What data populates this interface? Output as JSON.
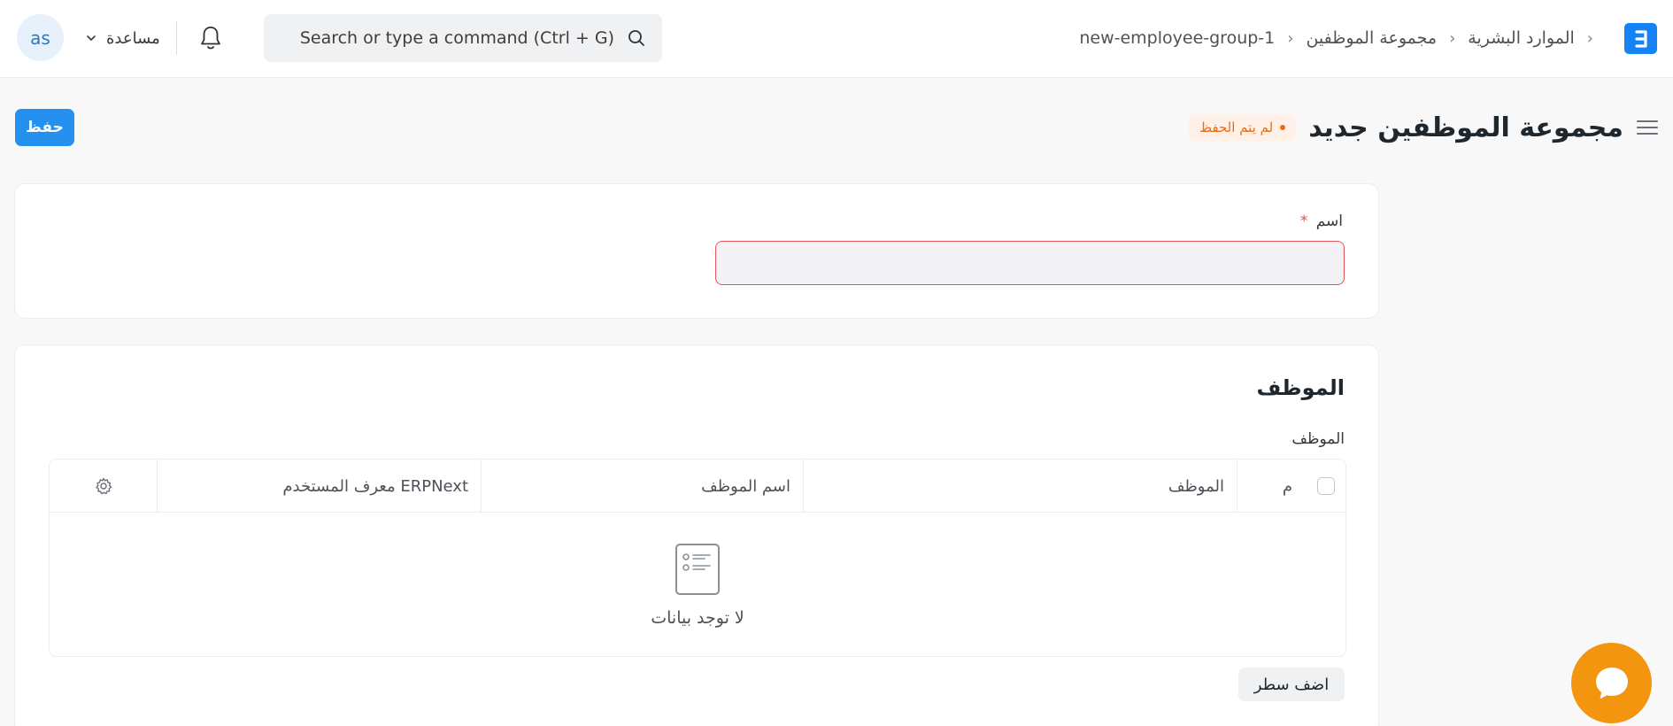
{
  "navbar": {
    "avatar_initials": "as",
    "help_label": "مساعدة",
    "search_placeholder": "Search or type a command (Ctrl + G)",
    "breadcrumb": [
      "new-employee-group-1",
      "مجموعة الموظفين",
      "الموارد البشرية"
    ]
  },
  "page": {
    "title": "مجموعة الموظفين جديد",
    "status": "لم يتم الحفظ",
    "save_label": "حفظ"
  },
  "form": {
    "name_label": "اسم",
    "required_mark": "*",
    "name_value": ""
  },
  "employees_section": {
    "title": "الموظف",
    "table_label": "الموظف",
    "columns": {
      "no": "م",
      "employee": "الموظف",
      "employee_name": "اسم الموظف",
      "erpnext_user": "معرف المستخدم ERPNext"
    },
    "empty_text": "لا توجد بيانات",
    "add_row_label": "اضف سطر"
  },
  "colors": {
    "primary": "#2490ef",
    "logo": "#1583f5",
    "status": "#e86c13",
    "chat": "#f3950e",
    "required_border": "#e6545a"
  },
  "icons": [
    "bell-icon",
    "search-icon",
    "chevron-down-icon",
    "menu-icon",
    "gear-icon",
    "empty-list-icon",
    "chat-icon",
    "erpnext-logo-icon"
  ]
}
